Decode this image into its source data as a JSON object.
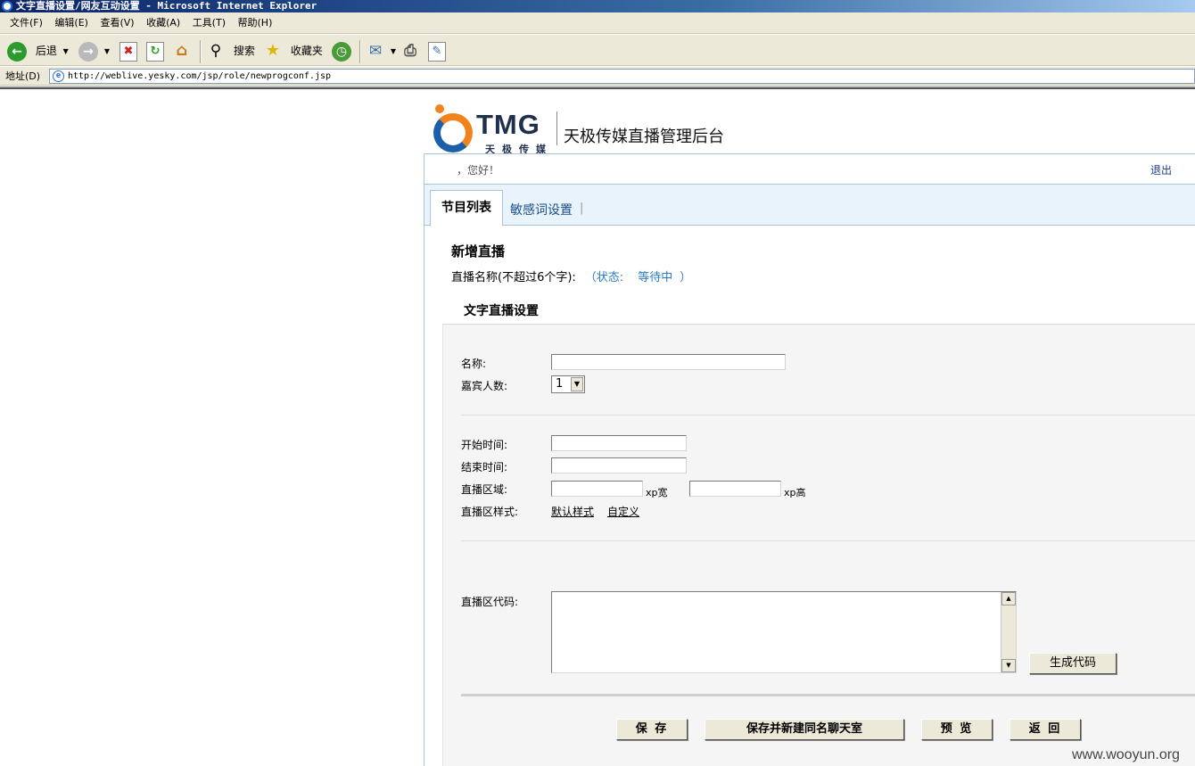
{
  "window": {
    "title": "文字直播设置/网友互动设置 - Microsoft Internet Explorer",
    "menu": [
      "文件(F)",
      "编辑(E)",
      "查看(V)",
      "收藏(A)",
      "工具(T)",
      "帮助(H)"
    ],
    "toolbar": {
      "back": "后退",
      "search": "搜索",
      "favorites": "收藏夹"
    },
    "address_label": "地址(D)",
    "address_url": "http://weblive.yesky.com/jsp/role/newprogconf.jsp"
  },
  "header": {
    "logo_text": "TMG",
    "logo_sub": "天极传媒",
    "site_title": "天极传媒直播管理后台",
    "greeting": "，您好！",
    "logout": "退出"
  },
  "tabs": {
    "programs": "节目列表",
    "sensitive_words": "敏感词设置",
    "separator": "|"
  },
  "section": {
    "title": "新增直播",
    "name_hint": "直播名称(不超过6个字):",
    "status_label": "（状态:",
    "status_value": "等待中",
    "status_close": "）",
    "subtitle": "文字直播设置"
  },
  "form": {
    "name_label": "名称:",
    "name_value": "",
    "guests_label": "嘉宾人数:",
    "guests_value": "1",
    "start_label": "开始时间:",
    "start_value": "",
    "end_label": "结束时间:",
    "end_value": "",
    "area_label": "直播区域:",
    "width_value": "",
    "width_unit": "xp宽",
    "height_value": "",
    "height_unit": "xp高",
    "style_label": "直播区样式:",
    "style_default": "默认样式",
    "style_custom": "自定义",
    "code_label": "直播区代码:",
    "code_value": "",
    "generate_button": "生成代码"
  },
  "actions": {
    "save": "保 存",
    "save_new_chat": "保存并新建同名聊天室",
    "preview": "预 览",
    "back": "返 回"
  },
  "watermark": "www.wooyun.org"
}
